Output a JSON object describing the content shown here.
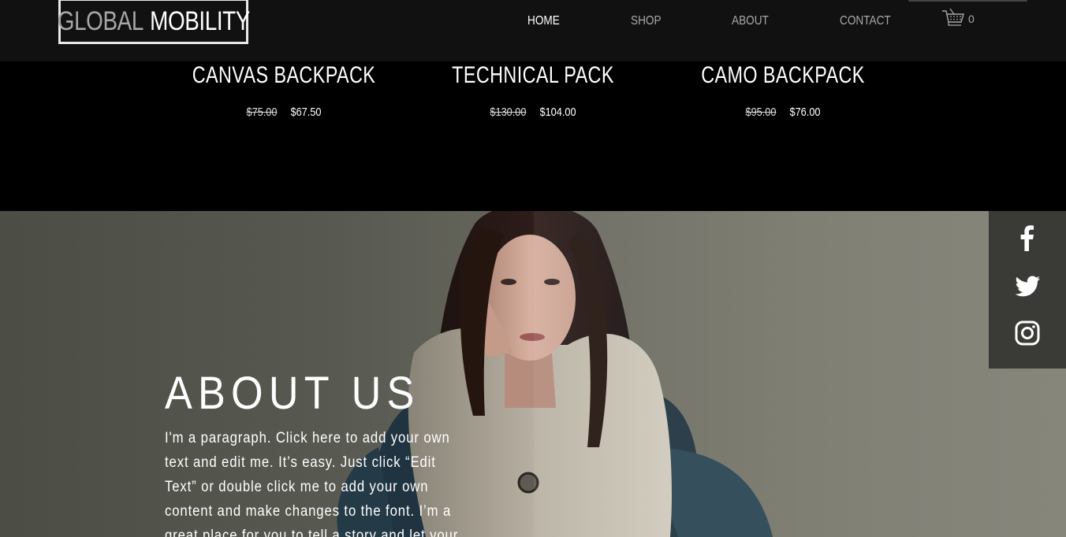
{
  "header": {
    "logo_word1": "GLOBAL",
    "logo_word2": "MOBILITY",
    "nav": [
      {
        "label": "HOME",
        "active": true
      },
      {
        "label": "SHOP",
        "active": false
      },
      {
        "label": "ABOUT",
        "active": false
      },
      {
        "label": "CONTACT",
        "active": false
      }
    ],
    "cart_count": "0"
  },
  "products": [
    {
      "title": "CANVAS BACKPACK",
      "old_price": "$75.00",
      "new_price": "$67.50"
    },
    {
      "title": "TECHNICAL PACK",
      "old_price": "$130.00",
      "new_price": "$104.00"
    },
    {
      "title": "CAMO BACKPACK",
      "old_price": "$95.00",
      "new_price": "$76.00"
    }
  ],
  "about": {
    "title": "ABOUT US",
    "paragraph": "I'm a paragraph. Click here to add your own text and edit me. It’s easy. Just click “Edit Text” or double click me to add your own content and make changes to the font. I’m a great place for you to tell a story and let your"
  },
  "social": {
    "icons": [
      "facebook-icon",
      "twitter-icon",
      "instagram-icon"
    ]
  },
  "colors": {
    "header_bg": "#111111",
    "page_bg": "#000000",
    "about_bg": "#575850",
    "social_bg": "#3a3a36",
    "nav_inactive": "#a9a9a9",
    "nav_active": "#ffffff"
  }
}
